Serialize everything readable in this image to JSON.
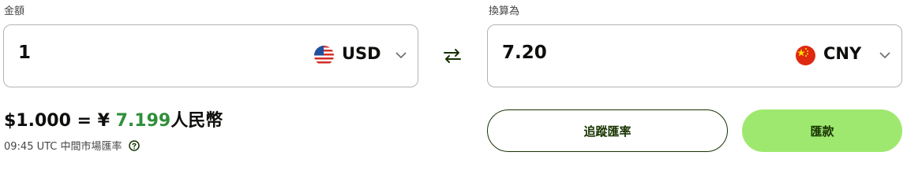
{
  "from": {
    "label": "金額",
    "amount": "1",
    "currency_code": "USD",
    "flag_icon": "us-flag-icon"
  },
  "to": {
    "label": "換算為",
    "amount": "7.20",
    "currency_code": "CNY",
    "flag_icon": "cn-flag-icon"
  },
  "swap_icon": "swap-arrows-icon",
  "rate": {
    "prefix": "$1.000 = ¥ ",
    "value": "7.199",
    "suffix": "人民幣"
  },
  "rate_meta": {
    "text": "09:45 UTC 中間市場匯率",
    "help_icon": "help-circle-icon"
  },
  "buttons": {
    "track_label": "追蹤匯率",
    "send_label": "匯款"
  },
  "colors": {
    "accent_green": "#9fe870",
    "dark_green": "#163300",
    "rate_green": "#2f8f3a"
  }
}
